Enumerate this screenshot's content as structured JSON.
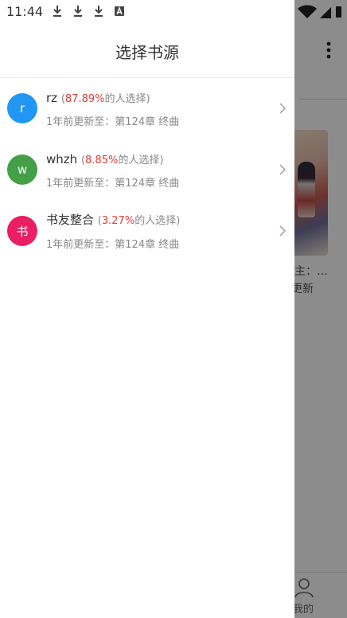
{
  "status_bar": {
    "time": "11:44"
  },
  "background": {
    "partial_title": "主：…",
    "partial_update": "更新",
    "bottom_tab_label": "我的"
  },
  "drawer": {
    "title": "选择书源",
    "sources": [
      {
        "avatar_letter": "r",
        "avatar_color": "#2196f3",
        "name": "rz",
        "percent": "87.89%",
        "suffix": "的人选择)",
        "update": "1年前更新至：第124章 终曲"
      },
      {
        "avatar_letter": "w",
        "avatar_color": "#43a047",
        "name": "whzh",
        "percent": "8.85%",
        "suffix": "的人选择)",
        "update": "1年前更新至：第124章 终曲"
      },
      {
        "avatar_letter": "书",
        "avatar_color": "#e91e63",
        "name": "书友整合",
        "percent": "3.27%",
        "suffix": "的人选择)",
        "update": "1年前更新至：第124章 终曲"
      }
    ]
  }
}
